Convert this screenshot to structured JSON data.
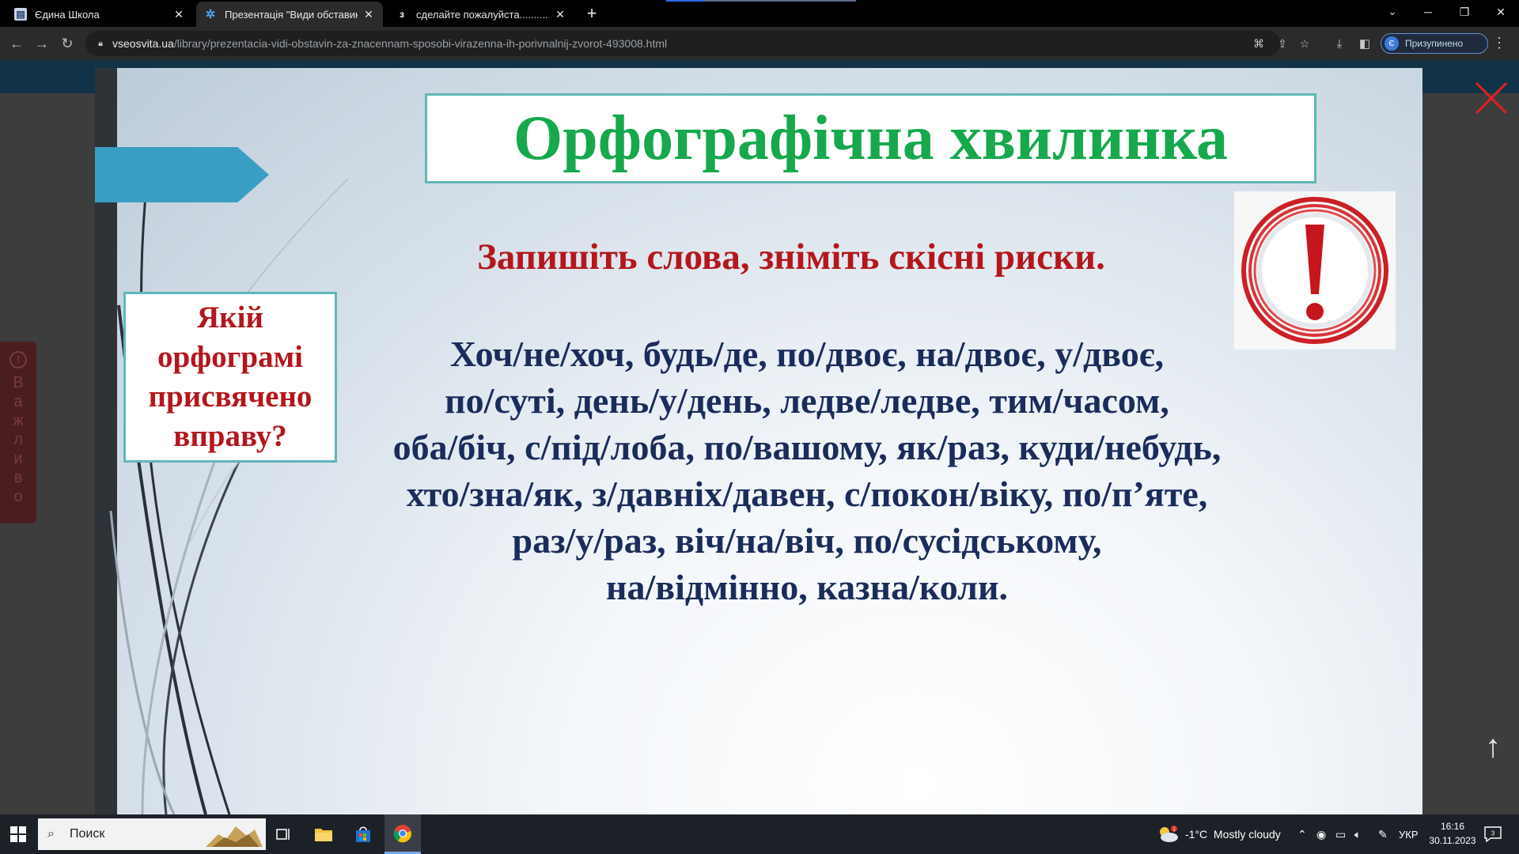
{
  "browser": {
    "tabs": [
      {
        "title": "Єдина Школа",
        "active": false
      },
      {
        "title": "Презентація \"Види обставин (з",
        "active": true
      },
      {
        "title": "сделайте пожалуйста...............",
        "active": false
      }
    ],
    "url_host": "vseosvita.ua",
    "url_path": "/library/prezentacia-vidi-obstavin-za-znacennam-sposobi-virazenna-ih-porivnalnij-zvorot-493008.html",
    "profile_label": "Призупинено",
    "profile_initial": "Є"
  },
  "page": {
    "side_tab_label": [
      "В",
      "а",
      "ж",
      "л",
      "и",
      "в",
      "о"
    ]
  },
  "slide": {
    "title": "Орфографічна хвилинка",
    "question_lines": [
      "Якій",
      "орфограмі",
      "присвячено",
      "вправу?"
    ],
    "instruction": "Запишіть слова, зніміть скісні риски.",
    "word_lines": [
      "Хоч/не/хоч,  будь/де, по/двоє, на/двоє,  у/двоє,",
      "по/суті, день/у/день, ледве/ледве, тим/часом,",
      "оба/біч, с/під/лоба, по/вашому, як/раз, куди/небудь,",
      "хто/зна/як, з/давніх/давен, с/покон/віку,  по/п’яте,",
      "раз/у/раз, віч/на/віч, по/сусідському,",
      "на/відмінно, казна/коли."
    ]
  },
  "taskbar": {
    "search_placeholder": "Поиск",
    "weather": "-1°C  Mostly cloudy",
    "weather_badge": "1",
    "language": "УКР",
    "time": "16:16",
    "date": "30.11.2023",
    "notification_count": "3"
  },
  "colors": {
    "title_green": "#17a84e",
    "accent_red": "#b3171c",
    "words_navy": "#1a2c5b",
    "box_border": "#60b7b9",
    "arrow_blue": "#3a9ec4"
  }
}
